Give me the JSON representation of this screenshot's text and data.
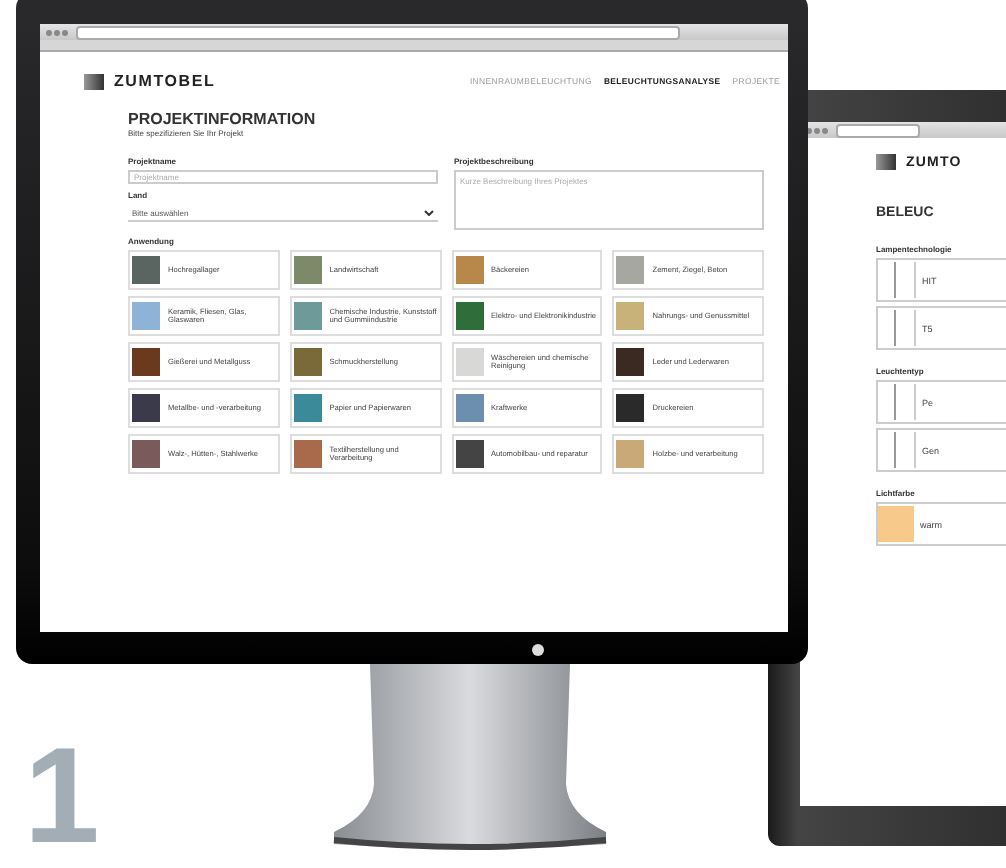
{
  "main_screen": {
    "logo": "ZUMTOBEL",
    "nav": [
      {
        "label": "INNENRAUMBELEUCHTUNG",
        "selected": false
      },
      {
        "label": "BELEUCHTUNGSANALYSE",
        "selected": true
      },
      {
        "label": "PROJEKTE",
        "selected": false
      }
    ],
    "heading": "PROJEKTINFORMATION",
    "subheading": "Bitte spezifizieren Sie Ihr Projekt",
    "project_name": {
      "label": "Projektname",
      "placeholder": "Projektname"
    },
    "project_description": {
      "label": "Projektbeschreibung",
      "placeholder": "Kurze Beschreibung Ihres Projektes"
    },
    "country": {
      "label": "Land",
      "value": "Bitte auswählen"
    },
    "application_label": "Anwendung",
    "applications": [
      {
        "label": "Hochregallager"
      },
      {
        "label": "Landwirtschaft"
      },
      {
        "label": "Bäckereien"
      },
      {
        "label": "Zement, Ziegel, Beton"
      },
      {
        "label": "Keramik, Fliesen, Glas, Glaswaren"
      },
      {
        "label": "Chemische Industrie, Kunststoff und Gummiindustrie"
      },
      {
        "label": "Elektro- und Elektronikindustrie"
      },
      {
        "label": "Nahrungs- und Genussmittel"
      },
      {
        "label": "Gießerei und Metallguss"
      },
      {
        "label": "Schmuckherstellung"
      },
      {
        "label": "Wäschereien und chemische Reinigung"
      },
      {
        "label": "Leder und Lederwaren"
      },
      {
        "label": "Metallbe- und -verarbeitung"
      },
      {
        "label": "Papier und Papierwaren"
      },
      {
        "label": "Kraftwerke"
      },
      {
        "label": "Druckereien"
      },
      {
        "label": "Walz-, Hütten-, Stahlwerke"
      },
      {
        "label": "Textilherstellung und Verarbeitung"
      },
      {
        "label": "Automobilbau- und reparatur"
      },
      {
        "label": "Holzbe- und verarbeitung"
      }
    ]
  },
  "second_screen": {
    "logo": "ZUMTO",
    "heading": "BELEUC",
    "sections": [
      {
        "label": "Lampentechnologie",
        "items": [
          "HIT",
          "T5"
        ]
      },
      {
        "label": "Leuchtentyp",
        "items": [
          "Pe",
          "Gen"
        ]
      },
      {
        "label": "Lichtfarbe",
        "items": [
          "warm"
        ]
      }
    ]
  },
  "step_number": "1"
}
